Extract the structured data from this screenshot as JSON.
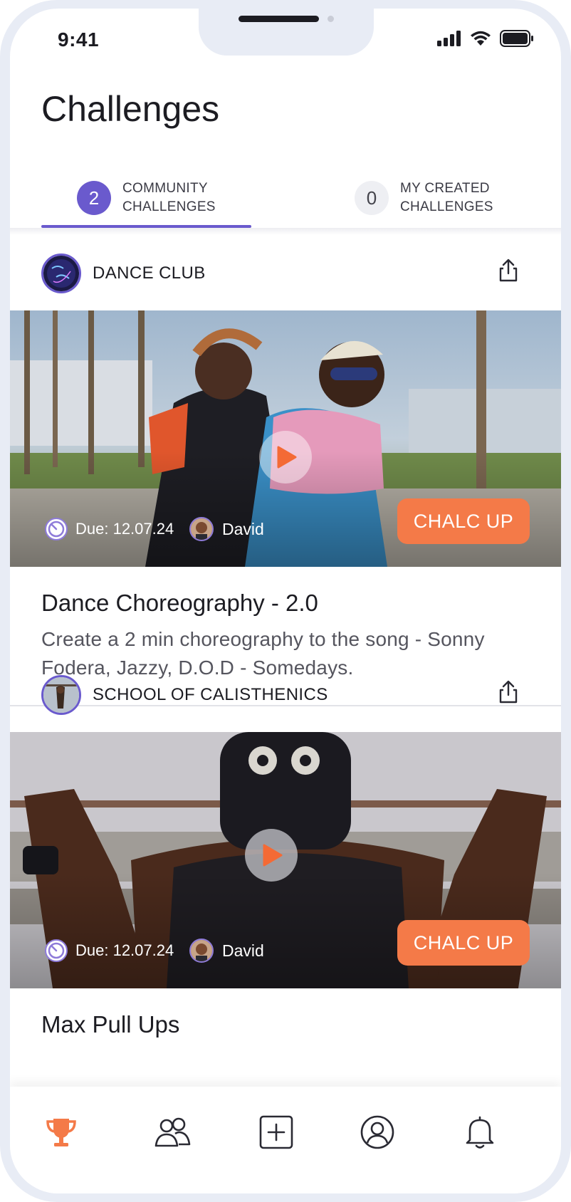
{
  "status_bar": {
    "time": "9:41"
  },
  "header": {
    "title": "Challenges"
  },
  "tabs": [
    {
      "count": "2",
      "label_line1": "COMMUNITY",
      "label_line2": "CHALLENGES",
      "active": true
    },
    {
      "count": "0",
      "label_line1": "MY CREATED",
      "label_line2": "CHALLENGES",
      "active": false
    }
  ],
  "challenges": [
    {
      "club": "DANCE CLUB",
      "due": "Due: 12.07.24",
      "author": "David",
      "cta": "CHALC UP",
      "title": "Dance Choreography - 2.0",
      "description": "Create a 2 min choreography to the song - Sonny Fodera, Jazzy, D.O.D - Somedays."
    },
    {
      "club": "SCHOOL OF CALISTHENICS",
      "due": "Due: 12.07.24",
      "author": "David",
      "cta": "CHALC UP",
      "title": "Max Pull Ups",
      "description": ""
    }
  ],
  "bottom_nav": [
    {
      "icon": "trophy-icon",
      "active": true
    },
    {
      "icon": "community-icon",
      "active": false
    },
    {
      "icon": "add-icon",
      "active": false
    },
    {
      "icon": "profile-icon",
      "active": false
    },
    {
      "icon": "bell-icon",
      "active": false
    }
  ],
  "colors": {
    "accent": "#6a5acd",
    "cta": "#f47a48",
    "text": "#1c1c22"
  }
}
